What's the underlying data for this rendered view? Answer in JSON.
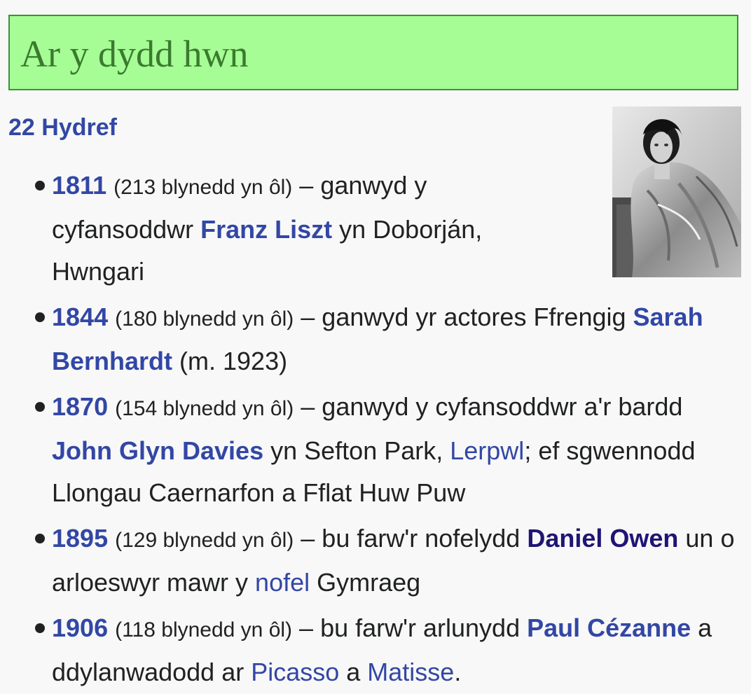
{
  "header": {
    "title": "Ar y dydd hwn"
  },
  "date_link": "22 Hydref",
  "photo": {
    "icon": "portrait-photo"
  },
  "events": [
    {
      "year": "1811",
      "ago": "(213 blynedd yn ôl)",
      "t1": " – ganwyd y cyfansoddwr ",
      "link1": "Franz Liszt",
      "t2": " yn Doborján, Hwngari"
    },
    {
      "year": "1844",
      "ago": "(180 blynedd yn ôl)",
      "t1": " – ganwyd yr actores Ffrengig ",
      "link1": "Sarah Bernhardt",
      "t2": " (m. 1923)"
    },
    {
      "year": "1870",
      "ago": "(154 blynedd yn ôl)",
      "t1": " – ganwyd y cyfansoddwr a'r bardd ",
      "link1": "John Glyn Davies",
      "t2": " yn Sefton Park, ",
      "link2": "Lerpwl",
      "t3": "; ef sgwennodd Llongau Caernarfon a Fflat Huw Puw"
    },
    {
      "year": "1895",
      "ago": "(129 blynedd yn ôl)",
      "t1": " – bu farw'r nofelydd ",
      "link1": "Daniel Owen",
      "t2": " un o arloeswyr mawr y ",
      "link2": "nofel",
      "t3": " Gymraeg"
    },
    {
      "year": "1906",
      "ago": "(118 blynedd yn ôl)",
      "t1": " – bu farw'r arlunydd ",
      "link1": "Paul Cézanne",
      "t2": " a ddylanwadodd ar ",
      "link2": "Picasso",
      "t3": " a ",
      "link3": "Matisse",
      "t4": "."
    }
  ]
}
